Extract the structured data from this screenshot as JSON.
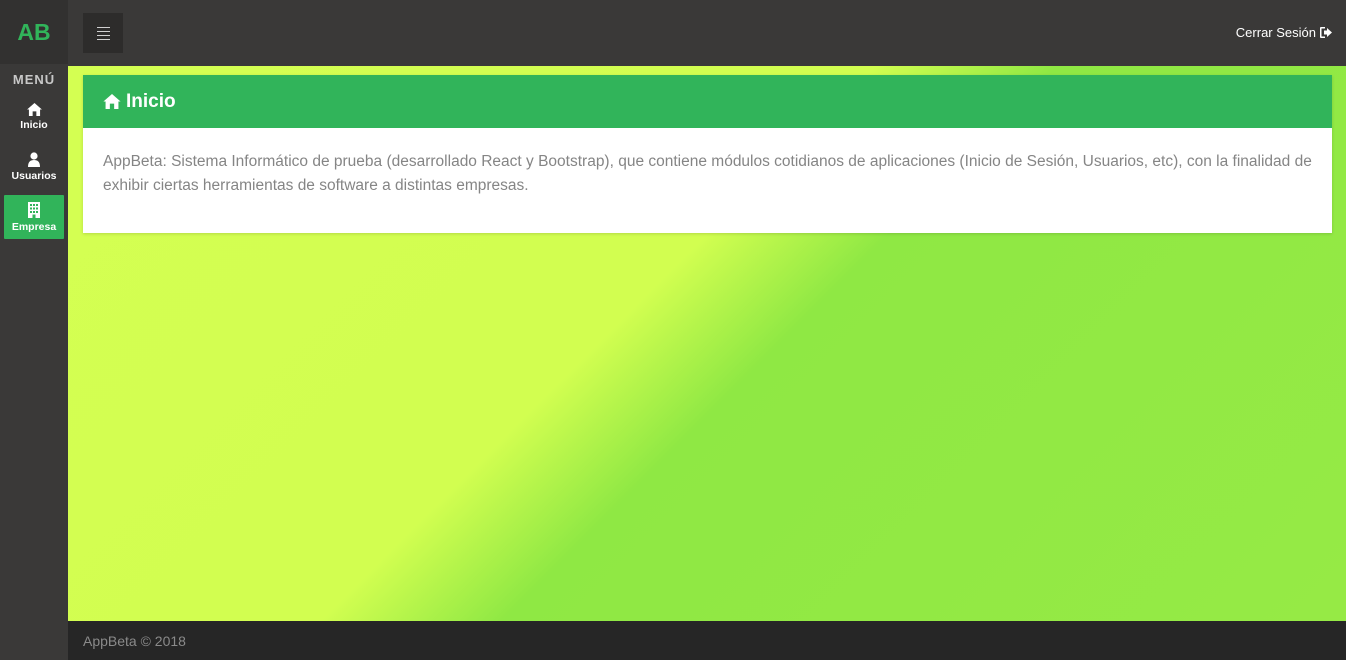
{
  "brand": {
    "logo_text": "AB",
    "color": "#31b45a"
  },
  "sidebar": {
    "menu_title": "MENÚ",
    "items": [
      {
        "label": "Inicio",
        "icon": "home-icon",
        "active": false
      },
      {
        "label": "Usuarios",
        "icon": "user-icon",
        "active": false
      },
      {
        "label": "Empresa",
        "icon": "building-icon",
        "active": true
      }
    ]
  },
  "topbar": {
    "menu_toggle_icon": "hamburger-icon",
    "logout_label": "Cerrar Sesión",
    "logout_icon": "sign-out-icon"
  },
  "panel": {
    "title": "Inicio",
    "title_icon": "home-icon",
    "body": "AppBeta: Sistema Informático de prueba (desarrollado React y Bootstrap), que contiene módulos cotidianos de aplicaciones (Inicio de Sesión, Usuarios, etc), con la finalidad de exhibir ciertas herramientas de software a distintas empresas."
  },
  "footer": {
    "text": "AppBeta © 2018"
  },
  "colors": {
    "accent": "#31b45a",
    "sidebar_bg": "#3a3938",
    "footer_bg": "#262626",
    "content_gradient_start": "#d4ff52",
    "content_gradient_end": "#96ea45"
  }
}
